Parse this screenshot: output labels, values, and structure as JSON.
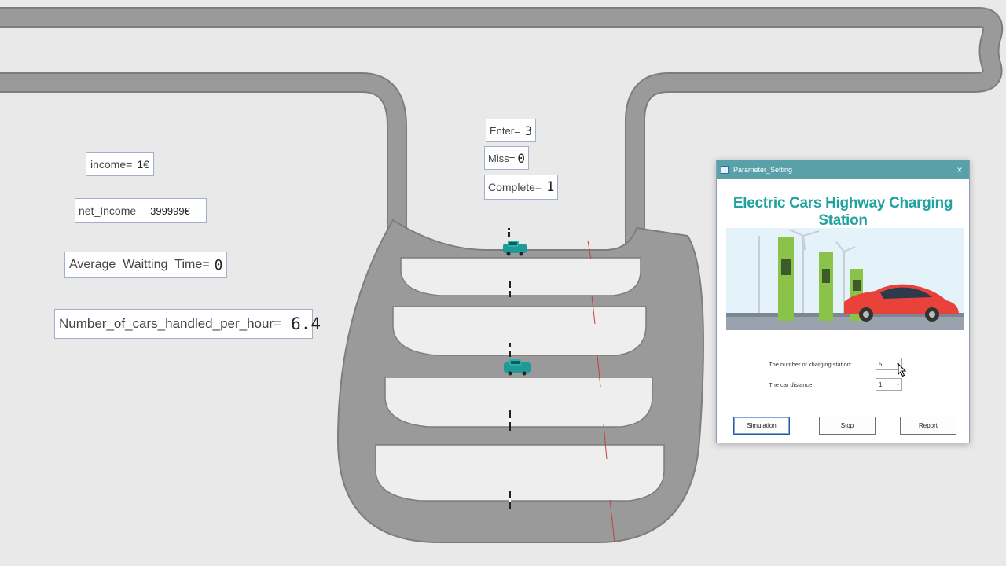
{
  "stats": {
    "income": {
      "label": "income=",
      "value": "1€"
    },
    "net_income": {
      "label": "net_Income",
      "value": "399999€"
    },
    "avg_wait": {
      "label": "Average_Waitting_Time=",
      "value": "0"
    },
    "cars_per_hour": {
      "label": "Number_of_cars_handled_per_hour=",
      "value": "6.4"
    },
    "enter": {
      "label": "Enter=",
      "value": "3"
    },
    "miss": {
      "label": "Miss=",
      "value": "0"
    },
    "complete": {
      "label": "Complete=",
      "value": "1"
    }
  },
  "dialog": {
    "window_title": "Parameter_Setting",
    "close_symbol": "×",
    "heading": "Electric Cars Highway Charging Station",
    "fields": [
      {
        "label": "The number of charging station:",
        "value": "5"
      },
      {
        "label": "The car distance:",
        "value": "1"
      }
    ],
    "buttons": {
      "simulation": "Simulation",
      "stop": "Stop",
      "report": "Report"
    }
  },
  "colors": {
    "road": "#9a9a9a",
    "road_edge": "#7d7d7d",
    "background": "#e9e9ea",
    "car": "#1f9a96",
    "accent_title": "#20a3a0",
    "titlebar": "#5aa0a9"
  },
  "icons": [
    "car-icon",
    "charger-post-icon",
    "cursor-icon",
    "close-icon",
    "window-app-icon"
  ]
}
